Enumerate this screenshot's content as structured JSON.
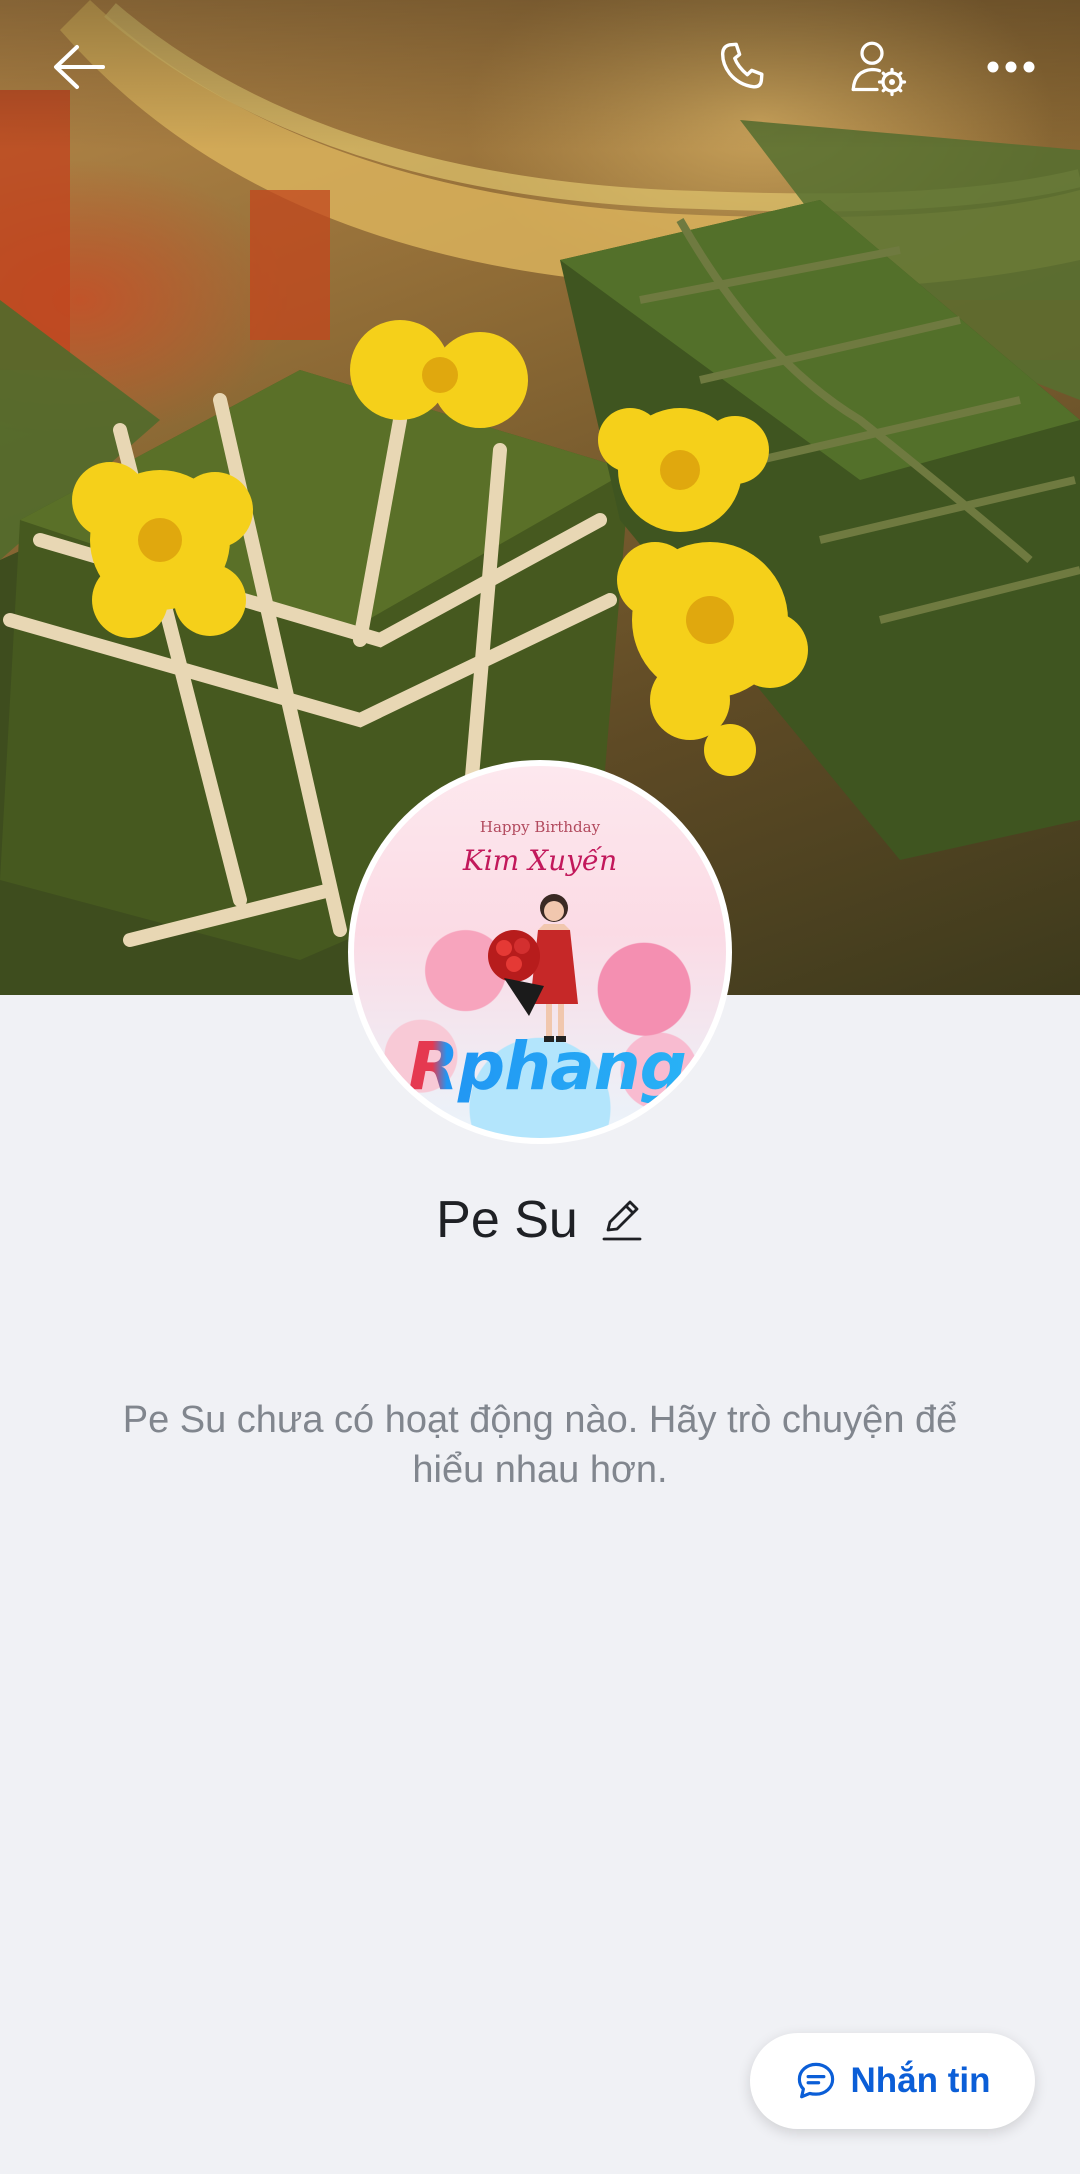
{
  "profile": {
    "name": "Pe Su",
    "empty_message": "Pe Su chưa có hoạt động nào. Hãy trò chuyện để hiểu nhau hơn."
  },
  "avatar": {
    "line1": "Happy Birthday",
    "line2": "Kim Xuyến",
    "watermark": "Rphang"
  },
  "topbar": {
    "icons": [
      "back-arrow-icon",
      "phone-icon",
      "user-settings-icon",
      "more-icon"
    ]
  },
  "actions": {
    "message_label": "Nhắn tin",
    "message_icon": "chat-bubble-icon"
  },
  "colors": {
    "accent": "#0b5ed7",
    "background": "#f0f1f5",
    "name_text": "#1f2125",
    "muted_text": "#81868e"
  }
}
